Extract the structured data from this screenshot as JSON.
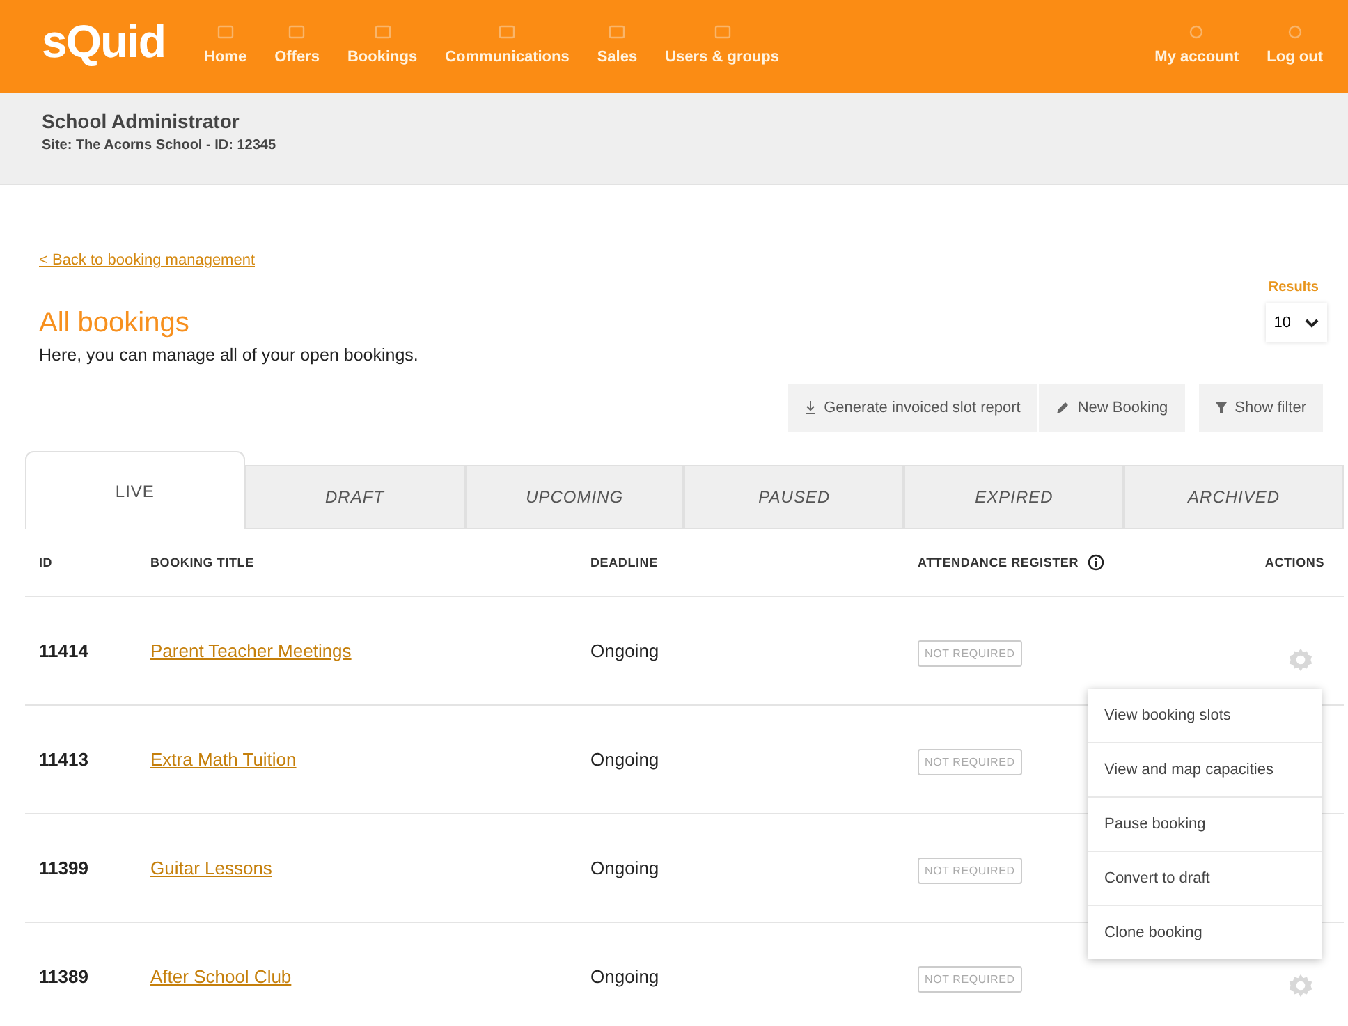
{
  "header": {
    "logo": "sQuid",
    "nav": [
      {
        "label": "Home"
      },
      {
        "label": "Offers"
      },
      {
        "label": "Bookings"
      },
      {
        "label": "Communications"
      },
      {
        "label": "Sales"
      },
      {
        "label": "Users & groups"
      }
    ],
    "right": [
      {
        "label": "My account"
      },
      {
        "label": "Log out"
      }
    ]
  },
  "subheader": {
    "role": "School Administrator",
    "site": "Site: The Acorns School - ID: 12345"
  },
  "back_link": "< Back to booking management",
  "title": "All bookings",
  "subtitle": "Here, you can manage all of your open bookings.",
  "results": {
    "label": "Results",
    "value": "10"
  },
  "toolbar": [
    {
      "label": "Generate invoiced slot report"
    },
    {
      "label": "New Booking"
    },
    {
      "label": "Show filter"
    }
  ],
  "tabs": [
    {
      "label": "LIVE",
      "selected": true
    },
    {
      "label": "DRAFT",
      "selected": false
    },
    {
      "label": "UPCOMING",
      "selected": false
    },
    {
      "label": "PAUSED",
      "selected": false
    },
    {
      "label": "EXPIRED",
      "selected": false
    },
    {
      "label": "ARCHIVED",
      "selected": false
    }
  ],
  "table": {
    "columns": [
      "ID",
      "BOOKING TITLE",
      "DEADLINE",
      "ATTENDANCE REGISTER",
      "ACTIONS"
    ],
    "rows": [
      {
        "id": "11414",
        "title": "Parent Teacher Meetings",
        "deadline": "Ongoing",
        "register": "NOT REQUIRED",
        "menu_open": true
      },
      {
        "id": "11413",
        "title": "Extra Math Tuition",
        "deadline": "Ongoing",
        "register": "NOT REQUIRED",
        "menu_open": false
      },
      {
        "id": "11399",
        "title": "Guitar Lessons",
        "deadline": "Ongoing",
        "register": "NOT REQUIRED",
        "menu_open": false
      },
      {
        "id": "11389",
        "title": "After School Club",
        "deadline": "Ongoing",
        "register": "NOT REQUIRED",
        "menu_open": false
      }
    ]
  },
  "action_menu": [
    "View booking slots",
    "View and map capacities",
    "Pause booking",
    "Convert to draft",
    "Clone booking"
  ]
}
